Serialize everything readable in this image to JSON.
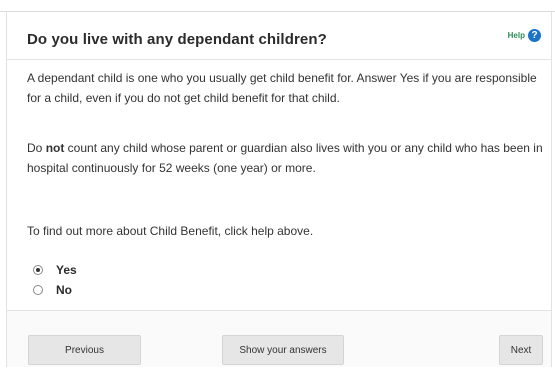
{
  "question": {
    "title": "Do you live with any dependant children?",
    "help_label": "Help",
    "help_icon_glyph": "?"
  },
  "body": {
    "paragraph_1": "A dependant child is one who you usually get child benefit for. Answer Yes if you are responsible for a child, even if you do not get child benefit for that child.",
    "paragraph_2_before": "Do ",
    "paragraph_2_emphasis": "not",
    "paragraph_2_after": " count any child whose parent or guardian also lives with you or any child who has been in hospital continuously for 52 weeks (one year) or more.",
    "paragraph_3": "To find out more about Child Benefit, click help above."
  },
  "options": [
    {
      "label": "Yes",
      "selected": true
    },
    {
      "label": "No",
      "selected": false
    }
  ],
  "footer": {
    "previous_label": "Previous",
    "show_answers_label": "Show your answers",
    "next_label": "Next"
  },
  "colors": {
    "help_icon": "#1a73c8",
    "help_text": "#2e8b57",
    "button_bg": "#e6e6e6"
  }
}
